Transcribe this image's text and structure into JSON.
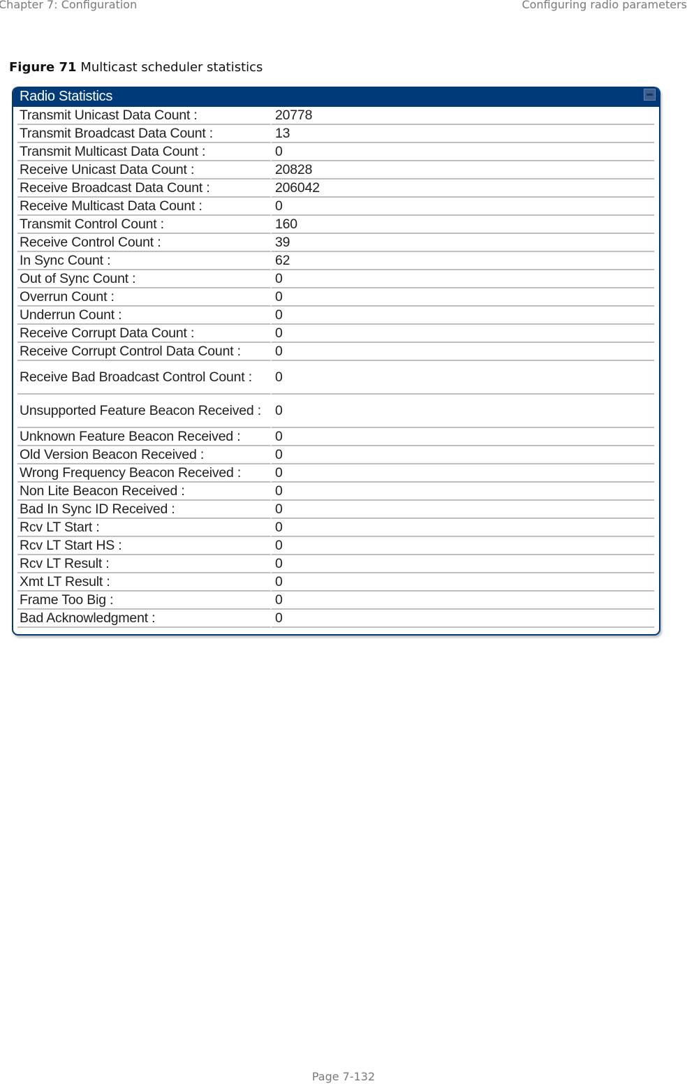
{
  "header": {
    "chapter": "Chapter 7:  Configuration",
    "section": "Configuring radio parameters"
  },
  "figure": {
    "number": "Figure 71",
    "caption": "Multicast scheduler statistics"
  },
  "panel": {
    "title": "Radio Statistics",
    "collapse_icon": "minus-box-icon",
    "rows": [
      {
        "label": "Transmit Unicast Data Count :",
        "value": "20778"
      },
      {
        "label": "Transmit Broadcast Data Count :",
        "value": "13"
      },
      {
        "label": "Transmit Multicast Data Count :",
        "value": "0"
      },
      {
        "label": "Receive Unicast Data Count :",
        "value": "20828"
      },
      {
        "label": "Receive Broadcast Data Count :",
        "value": "206042"
      },
      {
        "label": "Receive Multicast Data Count :",
        "value": "0"
      },
      {
        "label": "Transmit Control Count :",
        "value": "160"
      },
      {
        "label": "Receive Control Count :",
        "value": "39"
      },
      {
        "label": "In Sync Count :",
        "value": "62"
      },
      {
        "label": "Out of Sync Count :",
        "value": "0"
      },
      {
        "label": "Overrun Count :",
        "value": "0"
      },
      {
        "label": "Underrun Count :",
        "value": "0"
      },
      {
        "label": "Receive Corrupt Data Count :",
        "value": "0"
      },
      {
        "label": "Receive Corrupt Control Data Count :",
        "value": "0"
      },
      {
        "label": "Receive Bad Broadcast Control Count :",
        "value": "0"
      },
      {
        "label": "Unsupported Feature Beacon Received :",
        "value": "0"
      },
      {
        "label": "Unknown Feature Beacon Received :",
        "value": "0"
      },
      {
        "label": "Old Version Beacon Received :",
        "value": "0"
      },
      {
        "label": "Wrong Frequency Beacon Received :",
        "value": "0"
      },
      {
        "label": "Non Lite Beacon Received :",
        "value": "0"
      },
      {
        "label": "Bad In Sync ID Received :",
        "value": "0"
      },
      {
        "label": "Rcv LT Start :",
        "value": "0"
      },
      {
        "label": "Rcv LT Start HS :",
        "value": "0"
      },
      {
        "label": "Rcv LT Result :",
        "value": "0"
      },
      {
        "label": "Xmt LT Result :",
        "value": "0"
      },
      {
        "label": "Frame Too Big :",
        "value": "0"
      },
      {
        "label": "Bad Acknowledgment :",
        "value": "0"
      }
    ]
  },
  "footer": {
    "page": "Page 7-132"
  }
}
